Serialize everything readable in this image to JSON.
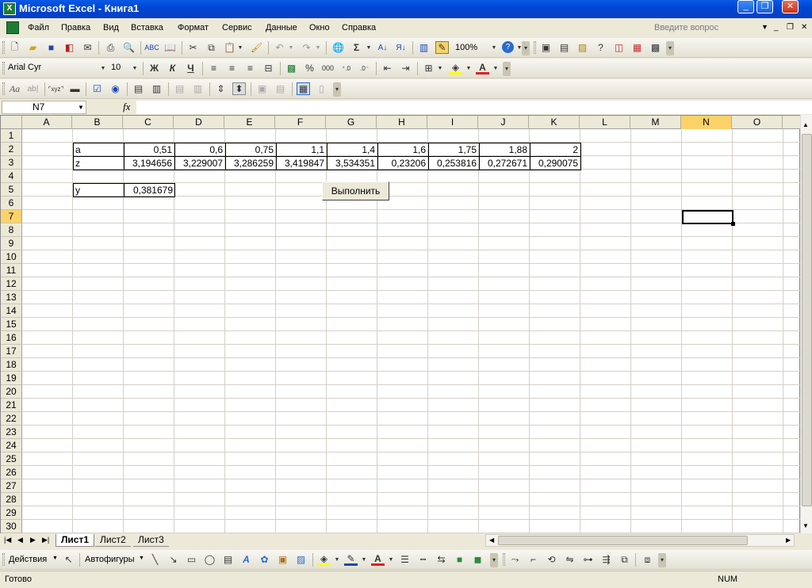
{
  "app": {
    "title": "Microsoft Excel - Книга1",
    "icon": "excel-app-icon"
  },
  "window_controls": {
    "minimize": "_",
    "restore": "❐",
    "close": "✕"
  },
  "menu": {
    "items": [
      "Файл",
      "Правка",
      "Вид",
      "Вставка",
      "Формат",
      "Сервис",
      "Данные",
      "Окно",
      "Справка"
    ],
    "help_placeholder": "Введите вопрос"
  },
  "toolbar": {
    "zoom": "100%",
    "font_name": "Arial Cyr",
    "font_size": "10",
    "bold": "Ж",
    "italic": "К",
    "underline": "Ч",
    "percent": "%",
    "thousands": "000",
    "sigma": "Σ",
    "font_color_letter": "A"
  },
  "formula_bar": {
    "name_box": "N7",
    "fx": "fx",
    "formula": ""
  },
  "grid": {
    "columns": [
      "A",
      "B",
      "C",
      "D",
      "E",
      "F",
      "G",
      "H",
      "I",
      "J",
      "K",
      "L",
      "M",
      "N",
      "O"
    ],
    "rows": [
      "1",
      "2",
      "3",
      "4",
      "5",
      "6",
      "7",
      "8",
      "9",
      "10",
      "11",
      "12",
      "13",
      "14",
      "15",
      "16",
      "17",
      "18",
      "19",
      "20",
      "21",
      "22",
      "23",
      "24",
      "25",
      "26",
      "27",
      "28",
      "29",
      "30"
    ],
    "selected_cell": "N7",
    "row2": {
      "label": "a",
      "values": [
        "0,51",
        "0,6",
        "0,75",
        "1,1",
        "1,4",
        "1,6",
        "1,75",
        "1,88",
        "2"
      ]
    },
    "row3": {
      "label": "z",
      "values": [
        "3,194656",
        "3,229007",
        "3,286259",
        "3,419847",
        "3,534351",
        "0,23206",
        "0,253816",
        "0,272671",
        "0,290075"
      ]
    },
    "row5": {
      "label": "y",
      "value": "0,381679"
    },
    "button_label": "Выполнить"
  },
  "sheets": {
    "tabs": [
      "Лист1",
      "Лист2",
      "Лист3"
    ],
    "active": "Лист1"
  },
  "drawing": {
    "actions": "Действия",
    "autoshapes": "Автофигуры"
  },
  "status": {
    "left": "Готово",
    "num": "NUM"
  }
}
